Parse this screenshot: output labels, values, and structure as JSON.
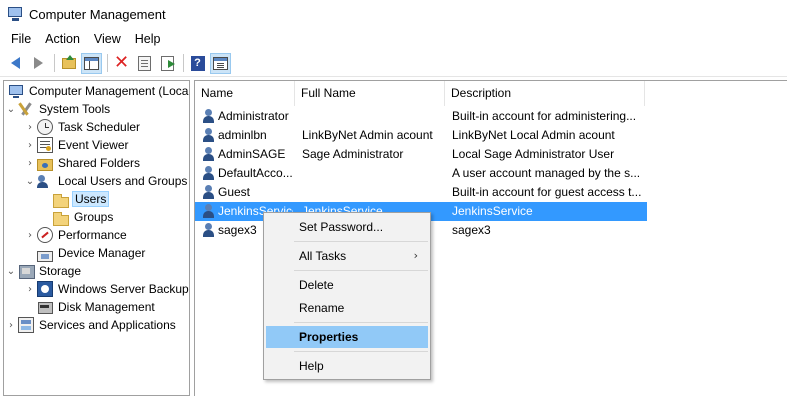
{
  "window": {
    "title": "Computer Management"
  },
  "menu": [
    "File",
    "Action",
    "View",
    "Help"
  ],
  "toolbar": {
    "buttons": [
      "back-icon",
      "forward-icon",
      "up-folder-icon",
      "show-console-tree-icon",
      "delete-icon",
      "properties-icon",
      "export-list-icon",
      "help-icon",
      "show-action-pane-icon"
    ]
  },
  "tree": {
    "root": "Computer Management (Local",
    "system_tools": "System Tools",
    "task_scheduler": "Task Scheduler",
    "event_viewer": "Event Viewer",
    "shared_folders": "Shared Folders",
    "local_users_groups": "Local Users and Groups",
    "users": "Users",
    "groups": "Groups",
    "performance": "Performance",
    "device_manager": "Device Manager",
    "storage": "Storage",
    "windows_server_backup": "Windows Server Backup",
    "disk_management": "Disk Management",
    "services_apps": "Services and Applications"
  },
  "list": {
    "columns": {
      "name": "Name",
      "full_name": "Full Name",
      "description": "Description"
    },
    "rows": [
      {
        "name": "Administrator",
        "full_name": "",
        "description": "Built-in account for administering..."
      },
      {
        "name": "adminlbn",
        "full_name": "LinkByNet Admin acount",
        "description": "LinkByNet Local Admin acount"
      },
      {
        "name": "AdminSAGE",
        "full_name": "Sage Administrator",
        "description": "Local Sage Administrator User"
      },
      {
        "name": "DefaultAcco...",
        "full_name": "",
        "description": "A user account managed by the s..."
      },
      {
        "name": "Guest",
        "full_name": "",
        "description": "Built-in account for guest access t..."
      },
      {
        "name": "JenkinsService",
        "full_name": "JenkinsService",
        "description": "JenkinsService"
      },
      {
        "name": "sagex3",
        "full_name": "",
        "description": "sagex3"
      }
    ]
  },
  "context_menu": {
    "set_password": "Set Password...",
    "all_tasks": "All Tasks",
    "all_tasks_arrow": "›",
    "delete": "Delete",
    "rename": "Rename",
    "properties": "Properties",
    "help": "Help"
  },
  "colors": {
    "selection": "#3399ff",
    "menu_hover": "#91c9f7",
    "tree_selected": "#cce8ff"
  }
}
